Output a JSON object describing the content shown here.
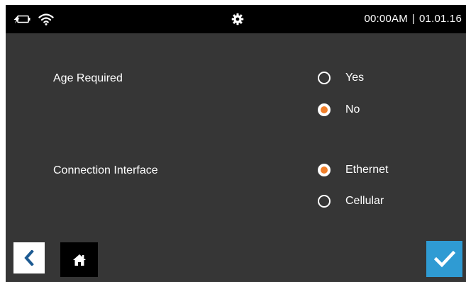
{
  "status_bar": {
    "icons": [
      "battery-charging-icon",
      "wifi-icon",
      "gear-icon"
    ],
    "time": "00:00AM",
    "separator": "|",
    "date": "01.01.16"
  },
  "settings": {
    "age_required": {
      "label": "Age Required",
      "options": [
        {
          "label": "Yes",
          "selected": false
        },
        {
          "label": "No",
          "selected": true
        }
      ]
    },
    "connection_interface": {
      "label": "Connection Interface",
      "options": [
        {
          "label": "Ethernet",
          "selected": true
        },
        {
          "label": "Cellular",
          "selected": false
        }
      ]
    }
  },
  "footer": {
    "icons": [
      "chevron-left-icon",
      "home-icon",
      "checkmark-icon"
    ]
  },
  "colors": {
    "background": "#363636",
    "status_bar": "#000000",
    "radio_selected": "#f07f2a",
    "confirm_button": "#2f9bd3",
    "back_chevron": "#1c5a92"
  }
}
